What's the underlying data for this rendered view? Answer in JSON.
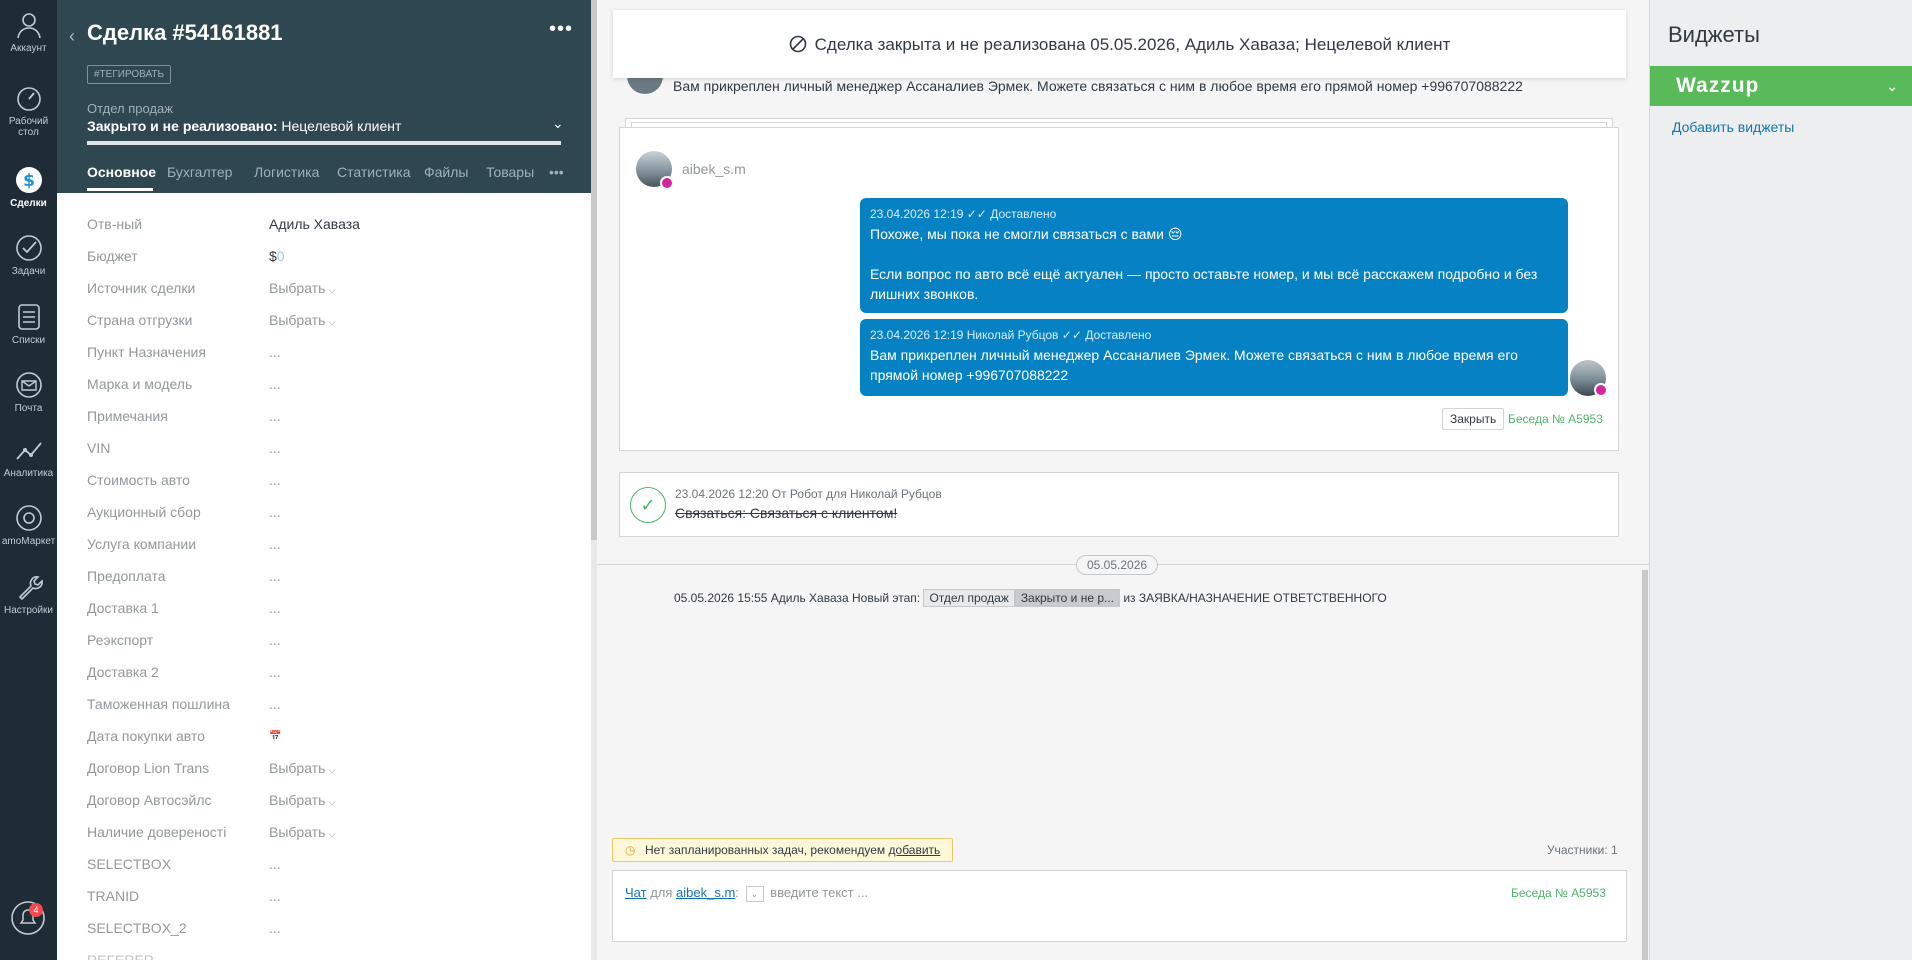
{
  "nav": {
    "items": [
      {
        "label": "Аккаунт",
        "icon": "user-icon"
      },
      {
        "label": "Рабочий стол",
        "icon": "dashboard-icon"
      },
      {
        "label": "Сделки",
        "icon": "deals-icon"
      },
      {
        "label": "Задачи",
        "icon": "tasks-icon"
      },
      {
        "label": "Списки",
        "icon": "lists-icon"
      },
      {
        "label": "Почта",
        "icon": "mail-icon"
      },
      {
        "label": "Аналитика",
        "icon": "analytics-icon"
      },
      {
        "label": "amoМаркет",
        "icon": "market-icon"
      },
      {
        "label": "Настройки",
        "icon": "settings-icon"
      }
    ],
    "notifications_count": "4"
  },
  "card": {
    "title": "Сделка #54161881",
    "tag_button": "#ТЕГИРОВАТЬ",
    "department": "Отдел продаж",
    "stage_bold": "Закрыто и не реализовано:",
    "stage_reason": "Нецелевой клиент",
    "tabs": [
      "Основное",
      "Бухгалтер",
      "Логистика",
      "Статистика",
      "Файлы",
      "Товары"
    ],
    "fields": [
      {
        "label": "Отв-ный",
        "value": "Адиль Хаваза"
      },
      {
        "label": "Бюджет",
        "value": "$",
        "value2": "0"
      },
      {
        "label": "Источник сделки",
        "value": "Выбрать"
      },
      {
        "label": "Страна отгрузки",
        "value": "Выбрать"
      },
      {
        "label": "Пункт Назначения",
        "value": "..."
      },
      {
        "label": "Марка и модель",
        "value": "..."
      },
      {
        "label": "Примечания",
        "value": "..."
      },
      {
        "label": "VIN",
        "value": "..."
      },
      {
        "label": "Стоимость авто",
        "value": "..."
      },
      {
        "label": "Аукционный сбор",
        "value": "..."
      },
      {
        "label": "Услуга компании",
        "value": "..."
      },
      {
        "label": "Предоплата",
        "value": "..."
      },
      {
        "label": "Доставка 1",
        "value": "..."
      },
      {
        "label": "Реэкспорт",
        "value": "..."
      },
      {
        "label": "Доставка 2",
        "value": "..."
      },
      {
        "label": "Таможенная пошлина",
        "value": "..."
      },
      {
        "label": "Дата покупки авто",
        "value": "📅"
      },
      {
        "label": "Договор Lion Trans",
        "value": "Выбрать"
      },
      {
        "label": "Договор Автосэйлс",
        "value": "Выбрать"
      },
      {
        "label": "Наличие довереності",
        "value": "Выбрать"
      },
      {
        "label": "SELECTBOX",
        "value": "..."
      },
      {
        "label": "TRANID",
        "value": "..."
      },
      {
        "label": "SELECTBOX_2",
        "value": "..."
      },
      {
        "label": "REFERER",
        "value": ""
      }
    ]
  },
  "feed": {
    "closed_banner": "Сделка закрыта и не реализована 05.05.2026, Адиль Хаваза; Нецелевой клиент",
    "prev_message": "Вам прикреплен личный менеджер Ассаналиев Эрмек. Можете связаться с ним в любое время его прямой номер +996707088222",
    "chat_user": "aibek_s.m",
    "messages": [
      {
        "meta": "23.04.2026 12:19  ✓✓ Доставлено",
        "line1": "Похоже, мы пока не смогли связаться с вами 😔",
        "line2": "Если вопрос по авто всё ещё актуален — просто оставьте номер, и мы всё расскажем подробно и без лишних звонков."
      },
      {
        "meta": "23.04.2026 12:19 Николай Рубцов  ✓✓ Доставлено",
        "line1": "Вам прикреплен личный менеджер Ассаналиев Эрмек. Можете связаться с ним в любое время его прямой номер +996707088222"
      }
    ],
    "close_button": "Закрыть",
    "conversation_link": "Беседа № А5953",
    "task_meta": "23.04.2026 12:20  От Робот для Николай Рубцов",
    "task_text": "Связаться: Связаться с клиентом!",
    "date_separator": "05.05.2026",
    "event_prefix": "05.05.2026 15:55 Адиль Хаваза Новый этап:",
    "event_pill1": "Отдел продаж",
    "event_pill2": "Закрыто и не р...",
    "event_suffix": "из ЗАЯВКА/НАЗНАЧЕНИЕ ОТВЕТСТВЕННОГО",
    "no_tasks_text": "Нет запланированных задач, рекомендуем",
    "no_tasks_link": "добавить",
    "participants": "Участники: 1",
    "composer_chat": "Чат",
    "composer_for": "для",
    "composer_user": "aibek_s.m",
    "composer_colon": ":",
    "composer_placeholder": "введите текст ...",
    "composer_conversation": "Беседа № А5953"
  },
  "widgets": {
    "title": "Виджеты",
    "wazzup": "Wazzup",
    "add_widgets": "Добавить виджеты"
  }
}
